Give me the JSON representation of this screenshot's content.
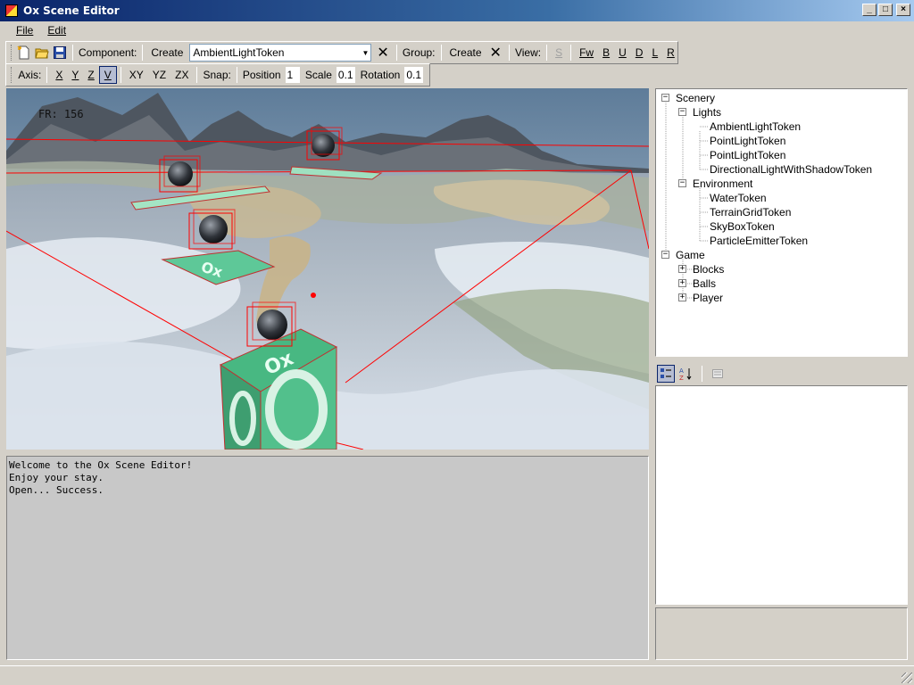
{
  "window": {
    "title": "Ox Scene Editor"
  },
  "menu": [
    "File",
    "Edit"
  ],
  "toolbar1": {
    "component_label": "Component:",
    "create_label": "Create",
    "component_value": "AmbientLightToken",
    "group_label": "Group:",
    "group_create_label": "Create",
    "view_label": "View:",
    "view_buttons": [
      "S",
      "Fw",
      "B",
      "U",
      "D",
      "L",
      "R"
    ]
  },
  "toolbar2": {
    "axis_label": "Axis:",
    "axes": [
      "X",
      "Y",
      "Z",
      "V",
      "XY",
      "YZ",
      "ZX"
    ],
    "active_axis": "V",
    "snap_label": "Snap:",
    "position_label": "Position",
    "position_value": "1",
    "scale_label": "Scale",
    "scale_value": "0.1",
    "rotation_label": "Rotation",
    "rotation_value": "0.1"
  },
  "viewport": {
    "frame_rate": "FR: 156",
    "logo_text": "Ox"
  },
  "console": [
    "Welcome to the Ox Scene Editor!",
    "Enjoy your stay.",
    "Open... Success."
  ],
  "tree": {
    "scenery": "Scenery",
    "lights": "Lights",
    "light_items": [
      "AmbientLightToken",
      "PointLightToken",
      "PointLightToken",
      "DirectionalLightWithShadowToken"
    ],
    "environment": "Environment",
    "env_items": [
      "WaterToken",
      "TerrainGridToken",
      "SkyBoxToken",
      "ParticleEmitterToken"
    ],
    "game": "Game",
    "game_items": [
      "Blocks",
      "Balls",
      "Player"
    ]
  },
  "icons": {
    "app": "scene-app-icon",
    "new": "new-file-icon",
    "open": "open-folder-icon",
    "save": "save-disk-icon",
    "close": "close-x-icon",
    "categorized": "categorized-icon",
    "alphabetical": "sort-az-icon",
    "pages": "property-pages-icon"
  },
  "colors": {
    "title_start": "#0a246a",
    "title_end": "#a6caf0",
    "face": "#d4d0c8",
    "selection_box": "#ff0000"
  }
}
